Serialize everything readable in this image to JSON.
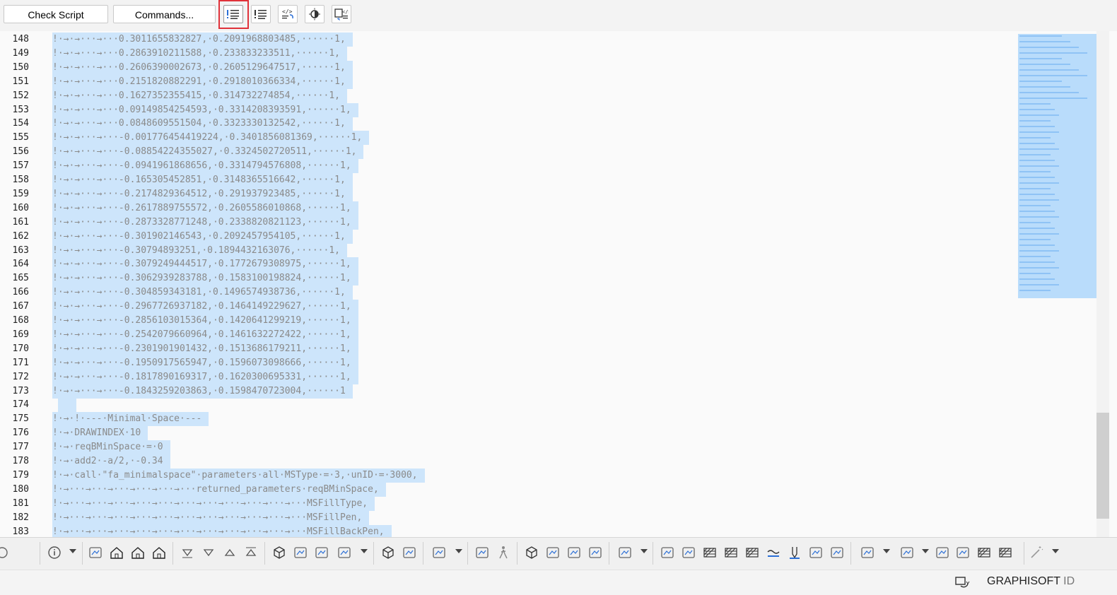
{
  "toolbar": {
    "check_script_label": "Check Script",
    "commands_label": "Commands...",
    "icons": [
      "comment-icon",
      "uncomment-icon",
      "format-code-icon",
      "theme-toggle-icon",
      "compare-script-icon"
    ]
  },
  "editor": {
    "lines": [
      {
        "n": "148",
        "text": "!·→·→···→···0.3011655832827,·0.2091968803485,······1,"
      },
      {
        "n": "149",
        "text": "!·→·→···→···0.2863910211588,·0.233833233511,······1,"
      },
      {
        "n": "150",
        "text": "!·→·→···→···0.2606390002673,·0.2605129647517,······1,"
      },
      {
        "n": "151",
        "text": "!·→·→···→···0.2151820882291,·0.2918010366334,······1,"
      },
      {
        "n": "152",
        "text": "!·→·→···→···0.1627352355415,·0.314732274854,······1,"
      },
      {
        "n": "153",
        "text": "!·→·→···→···0.09149854254593,·0.3314208393591,······1,"
      },
      {
        "n": "154",
        "text": "!·→·→···→···0.0848609551504,·0.3323330132542,······1,"
      },
      {
        "n": "155",
        "text": "!·→·→···→···-0.001776454419224,·0.3401856081369,······1,"
      },
      {
        "n": "156",
        "text": "!·→·→···→···-0.08854224355027,·0.3324502720511,······1,"
      },
      {
        "n": "157",
        "text": "!·→·→···→···-0.0941961868656,·0.3314794576808,······1,"
      },
      {
        "n": "158",
        "text": "!·→·→···→···-0.165305452851,·0.3148365516642,······1,"
      },
      {
        "n": "159",
        "text": "!·→·→···→···-0.2174829364512,·0.291937923485,······1,"
      },
      {
        "n": "160",
        "text": "!·→·→···→···-0.2617889755572,·0.2605586010868,······1,"
      },
      {
        "n": "161",
        "text": "!·→·→···→···-0.2873328771248,·0.2338820821123,······1,"
      },
      {
        "n": "162",
        "text": "!·→·→···→···-0.301902146543,·0.2092457954105,······1,"
      },
      {
        "n": "163",
        "text": "!·→·→···→···-0.30794893251,·0.1894432163076,······1,"
      },
      {
        "n": "164",
        "text": "!·→·→···→···-0.3079249444517,·0.1772679308975,······1,"
      },
      {
        "n": "165",
        "text": "!·→·→···→···-0.3062939283788,·0.1583100198824,······1,"
      },
      {
        "n": "166",
        "text": "!·→·→···→···-0.304859343181,·0.1496574938736,······1,"
      },
      {
        "n": "167",
        "text": "!·→·→···→···-0.2967726937182,·0.1464149229627,······1,"
      },
      {
        "n": "168",
        "text": "!·→·→···→···-0.2856103015364,·0.1420641299219,······1,"
      },
      {
        "n": "169",
        "text": "!·→·→···→···-0.2542079660964,·0.1461632272422,······1,"
      },
      {
        "n": "170",
        "text": "!·→·→···→···-0.2301901901432,·0.1513686179211,······1,"
      },
      {
        "n": "171",
        "text": "!·→·→···→···-0.1950917565947,·0.1596073098666,······1,"
      },
      {
        "n": "172",
        "text": "!·→·→···→···-0.1817890169317,·0.1620300695331,······1,"
      },
      {
        "n": "173",
        "text": "!·→·→···→···-0.1843259203863,·0.1598470723004,······1"
      },
      {
        "n": "174",
        "text": ""
      },
      {
        "n": "175",
        "text": "!·→·!·---·Minimal·Space·---"
      },
      {
        "n": "176",
        "text": "!·→·DRAWINDEX·10"
      },
      {
        "n": "177",
        "text": "!·→·reqBMinSpace·=·0"
      },
      {
        "n": "178",
        "text": "!·→·add2·-a/2,·-0.34"
      },
      {
        "n": "179",
        "text": "!·→·call·\"fa_minimalspace\"·parameters·all·MSType·=·3,·unID·=·3000,"
      },
      {
        "n": "180",
        "text": "!·→···→···→···→···→···→···returned_parameters·reqBMinSpace,"
      },
      {
        "n": "181",
        "text": "!·→···→···→···→···→···→···→···→···→···→···→···MSFillType,"
      },
      {
        "n": "182",
        "text": "!·→···→···→···→···→···→···→···→···→···→···→···MSFillPen,"
      },
      {
        "n": "183",
        "text": "!·→···→···→···→···→···→···→···→···→···→···→···MSFillBackPen,"
      }
    ]
  },
  "bottom_toolbar": {
    "icons": [
      "info-icon",
      "floor-plan-icon",
      "house-down-icon",
      "house-up-icon",
      "house-settings-icon",
      "triangle-down-bar-icon",
      "triangle-down-icon",
      "triangle-up-icon",
      "triangle-up-bar-icon",
      "3d-box-icon",
      "3d-axes-icon",
      "3d-explode-icon",
      "3d-diamond-icon",
      "cube-icon",
      "section-box-icon",
      "layer-settings-icon",
      "eye-icon",
      "walk-icon",
      "view-cube-icon",
      "home-view-icon",
      "orbit-icon",
      "camera-target-icon",
      "render-icon",
      "fill-bucket-icon",
      "brush-icon",
      "hatch-icon",
      "hatch-lines-icon",
      "hatch-diagonal-icon",
      "wave-icon",
      "pen-icon",
      "surface-icon",
      "check-icon",
      "layers-list-icon",
      "grid-icon",
      "mirror-icon",
      "split-icon",
      "stack-icon",
      "columns-icon",
      "wand-icon"
    ]
  },
  "status": {
    "brand": "GRAPHISOFT",
    "id_label": "ID"
  }
}
